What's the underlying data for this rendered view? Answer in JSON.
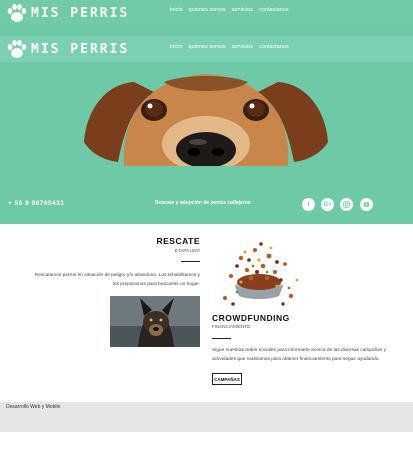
{
  "brand": {
    "name": "MIS PERRIS"
  },
  "nav": {
    "items": [
      {
        "label": "inicio"
      },
      {
        "label": "quienes somos"
      },
      {
        "label": "servicios"
      },
      {
        "label": "contactanos"
      }
    ]
  },
  "contact": {
    "phone": "+ 56 9 98765431",
    "tagline": "Rescate y adopción de perros callejeros",
    "social_icons": [
      "facebook-icon",
      "google-plus-icon",
      "instagram-icon",
      "youtube-icon"
    ]
  },
  "rescate": {
    "title": "RESCATE",
    "subtitle": "ETAPA UNO",
    "text": "Rescatamos perros en situación de peligro y/o abandono. Los rehabilitamos y los preparamos para buscarles un hogar."
  },
  "crowdfunding": {
    "title": "CROWDFUNDING",
    "subtitle": "FINANCIAMIENTO",
    "text": "Sigue nuestras redes sociales para informarte acerca de las diversas campañas y actividades que realizamos para obtener financiamiento para seguir ayudando.",
    "button_label": "CAMPAÑAS"
  },
  "footer": {
    "text": "Desarrollo Web y Mobile"
  },
  "colors": {
    "accent": "#6ec9a6",
    "footer": "#e6e6e6"
  }
}
